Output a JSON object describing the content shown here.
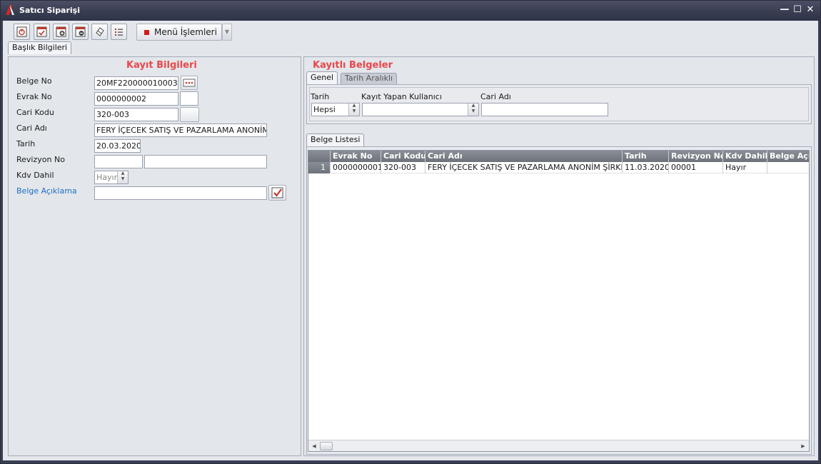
{
  "window": {
    "title": "Satıcı Siparişi",
    "minimize": "—",
    "maximize": "☐",
    "close": "✕"
  },
  "toolbar": {
    "menu_label": "Menü İşlemleri",
    "dropdown": "▼"
  },
  "tabs": {
    "header": "Başlık Bilgileri"
  },
  "left": {
    "title": "Kayıt Bilgileri",
    "belge_no": {
      "label": "Belge No",
      "value": "20MF220000010003"
    },
    "evrak_no": {
      "label": "Evrak No",
      "value": "0000000002"
    },
    "cari_kodu": {
      "label": "Cari Kodu",
      "value": "320-003"
    },
    "cari_adi": {
      "label": "Cari Adı",
      "value": "FERY İÇECEK SATIŞ VE PAZARLAMA ANONİM ŞİRKETİ"
    },
    "tarih": {
      "label": "Tarih",
      "value": "20.03.2020"
    },
    "revizyon_no": {
      "label": "Revizyon No",
      "value": "",
      "value2": ""
    },
    "kdv_dahil": {
      "label": "Kdv Dahil",
      "value": "Hayır"
    },
    "belge_aciklama": {
      "label": "Belge Açıklama",
      "value": ""
    }
  },
  "right": {
    "title": "Kayıtlı Belgeler",
    "filter_tabs": [
      "Genel",
      "Tarih Aralıklı"
    ],
    "filters": {
      "tarih": {
        "label": "Tarih",
        "value": "Hepsi"
      },
      "kullanici": {
        "label": "Kayıt Yapan Kullanıcı",
        "value": ""
      },
      "cari_adi": {
        "label": "Cari Adı",
        "value": ""
      }
    },
    "list_tab": "Belge Listesi",
    "grid": {
      "columns": [
        "Evrak No",
        "Cari Kodu",
        "Cari Adı",
        "Tarih",
        "Revizyon No",
        "Kdv Dahil",
        "Belge Açıklama"
      ],
      "rows": [
        {
          "num": "1",
          "evrak_no": "0000000001",
          "cari_kodu": "320-003",
          "cari_adi": "FERY İÇECEK SATIŞ VE PAZARLAMA ANONİM ŞİRKETİ",
          "tarih": "11.03.2020",
          "revizyon_no": "00001",
          "kdv_dahil": "Hayır",
          "belge_aciklama": ""
        }
      ]
    }
  },
  "colors": {
    "accent_title": "#e8484a",
    "link": "#1e6fc2",
    "titlebar": "#383c50"
  }
}
